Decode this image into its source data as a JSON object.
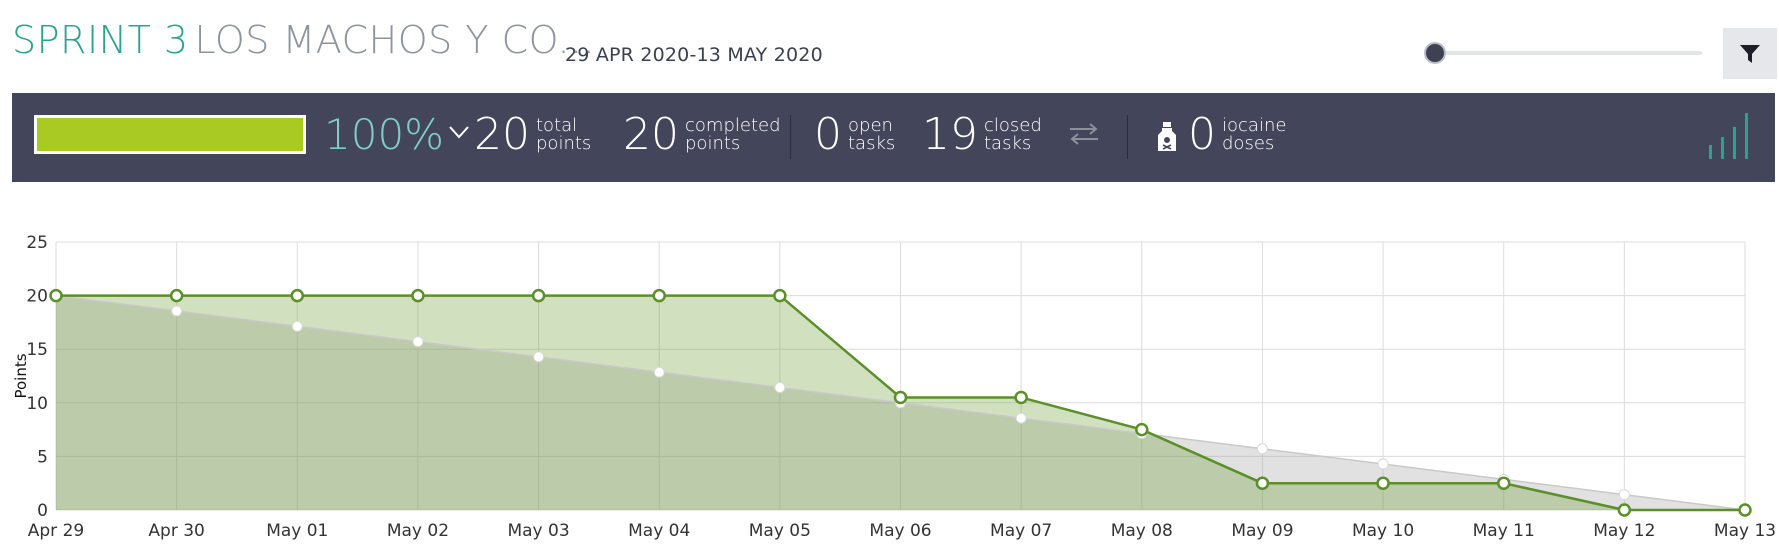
{
  "header": {
    "sprint_label": "SPRINT 3",
    "project_name": "LOS MACHOS Y CO...",
    "date_range": "29 APR 2020-13 MAY 2020",
    "filter_icon": "filter-icon",
    "slider_value": 0
  },
  "stats": {
    "progress_fraction": 1.0,
    "percent": "100%",
    "total_points": {
      "value": "20",
      "line1": "total",
      "line2": "points"
    },
    "completed_points": {
      "value": "20",
      "line1": "completed",
      "line2": "points"
    },
    "open_tasks": {
      "value": "0",
      "line1": "open",
      "line2": "tasks"
    },
    "closed_tasks": {
      "value": "19",
      "line1": "closed",
      "line2": "tasks"
    },
    "iocaine": {
      "value": "0",
      "line1": "iocaine",
      "line2": "doses"
    },
    "colors": {
      "bar_bg": "#43465a",
      "progress": "#a8ca23",
      "percent": "#7fcccd"
    }
  },
  "chart_data": {
    "type": "area",
    "ylabel": "Points",
    "xlabel": "",
    "ylim": [
      0,
      25
    ],
    "yticks": [
      0,
      5,
      10,
      15,
      20,
      25
    ],
    "categories": [
      "Apr 29",
      "Apr 30",
      "May 01",
      "May 02",
      "May 03",
      "May 04",
      "May 05",
      "May 06",
      "May 07",
      "May 08",
      "May 09",
      "May 10",
      "May 11",
      "May 12",
      "May 13"
    ],
    "grid": true,
    "series": [
      {
        "values": [
          20,
          18.57,
          17.14,
          15.71,
          14.29,
          12.86,
          11.43,
          10,
          8.57,
          7.14,
          5.71,
          4.29,
          2.86,
          1.43,
          0
        ],
        "color": "#c9c9c9"
      },
      {
        "values": [
          20,
          20,
          20,
          20,
          20,
          20,
          20,
          10.5,
          10.5,
          7.5,
          2.5,
          2.5,
          2.5,
          0,
          0
        ],
        "color": "#5a8f29"
      }
    ]
  }
}
